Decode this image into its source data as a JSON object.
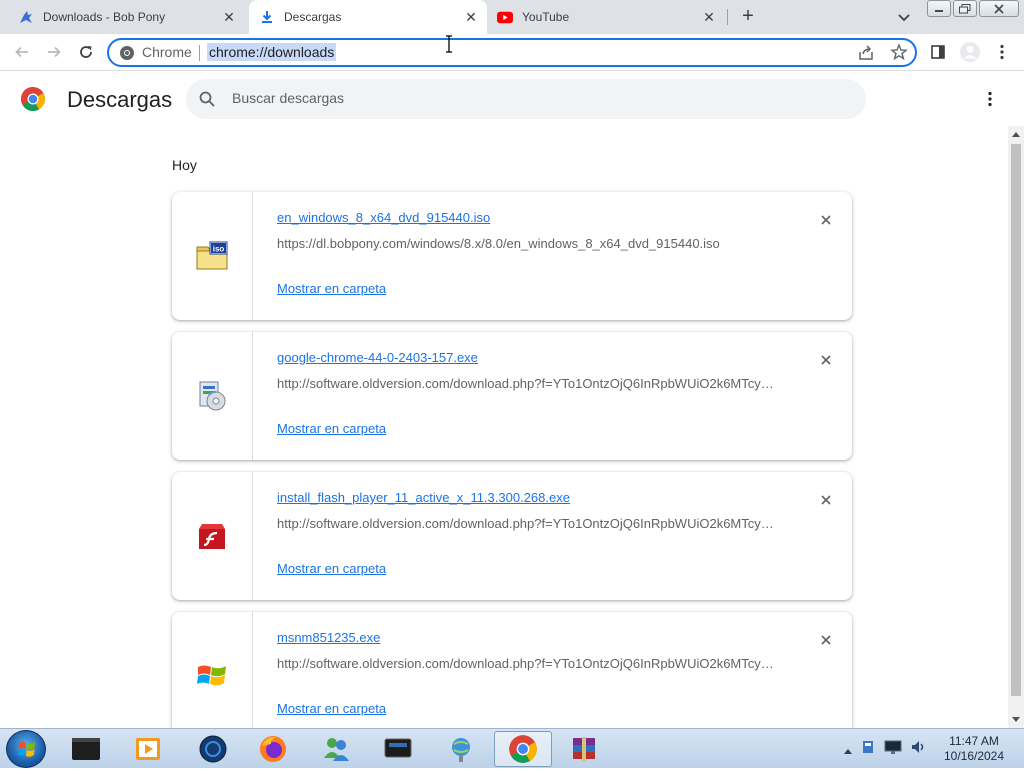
{
  "browser": {
    "tabs": [
      {
        "title": "Downloads - Bob Pony",
        "active": false,
        "icon": "bobpony-favicon"
      },
      {
        "title": "Descargas",
        "active": true,
        "icon": "download-icon"
      },
      {
        "title": "YouTube",
        "active": false,
        "icon": "youtube-icon"
      }
    ],
    "omnibox": {
      "chip": "Chrome",
      "url": "chrome://downloads"
    }
  },
  "page": {
    "title": "Descargas",
    "search_placeholder": "Buscar descargas",
    "section_label": "Hoy",
    "items": [
      {
        "name": "en_windows_8_x64_dvd_915440.iso",
        "url": "https://dl.bobpony.com/windows/8.x/8.0/en_windows_8_x64_dvd_915440.iso",
        "action": "Mostrar en carpeta",
        "icon": "iso-file-icon"
      },
      {
        "name": "google-chrome-44-0-2403-157.exe",
        "url": "http://software.oldversion.com/download.php?f=YTo1OntzOjQ6InRpbWUiO2k6MTcy…",
        "action": "Mostrar en carpeta",
        "icon": "installer-icon"
      },
      {
        "name": "install_flash_player_11_active_x_11.3.300.268.exe",
        "url": "http://software.oldversion.com/download.php?f=YTo1OntzOjQ6InRpbWUiO2k6MTcy…",
        "action": "Mostrar en carpeta",
        "icon": "flash-icon"
      },
      {
        "name": "msnm851235.exe",
        "url": "http://software.oldversion.com/download.php?f=YTo1OntzOjQ6InRpbWUiO2k6MTcy…",
        "action": "Mostrar en carpeta",
        "icon": "windows-flag-icon"
      }
    ]
  },
  "taskbar": {
    "time": "11:47 AM",
    "date": "10/16/2024"
  },
  "colors": {
    "accent": "#1a73e8",
    "tabstrip": "#dee1e6"
  }
}
